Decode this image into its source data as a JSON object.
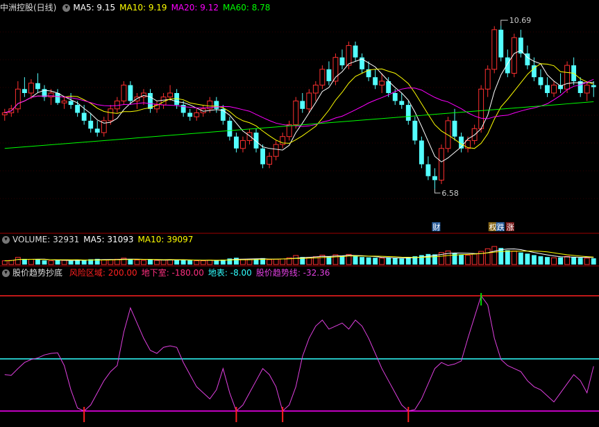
{
  "price_panel": {
    "title": "中洲控股(日线)",
    "indicators": [
      {
        "label": "MA5: 9.15",
        "color": "#ffffff"
      },
      {
        "label": "MA10: 9.19",
        "color": "#ffff00"
      },
      {
        "label": "MA20: 9.12",
        "color": "#ff00ff"
      },
      {
        "label": "MA60: 8.78",
        "color": "#00ff00"
      }
    ],
    "high_label": "10.69",
    "low_label": "6.58",
    "badges": [
      {
        "text": "财",
        "bg": "#2a5d9a"
      },
      {
        "text": "权",
        "bg": "#8a6a1a"
      },
      {
        "text": "跌",
        "bg": "#2a5d9a"
      },
      {
        "text": "涨",
        "bg": "#7a1a1a"
      }
    ]
  },
  "volume_panel": {
    "indicators": [
      {
        "label": "VOLUME: 32931",
        "color": "#dddddd"
      },
      {
        "label": "MA5: 31093",
        "color": "#ffffff"
      },
      {
        "label": "MA10: 39097",
        "color": "#ffff00"
      }
    ]
  },
  "indicator_panel": {
    "title": "股价趋势抄底",
    "indicators": [
      {
        "label": "风险区域: 200.00",
        "color": "#ff2020"
      },
      {
        "label": "地下室: -180.00",
        "color": "#ff3080"
      },
      {
        "label": "地表: -8.00",
        "color": "#30ffff"
      },
      {
        "label": "股价趋势线: -32.36",
        "color": "#e040e0"
      }
    ]
  },
  "chart_data": {
    "type": "candlestick",
    "price_range": [
      6.0,
      11.0
    ],
    "series_colors": {
      "up": "#ff3030",
      "down": "#54ffff",
      "ma5": "#ffffff",
      "ma10": "#ffff00",
      "ma20": "#ff00ff",
      "ma60": "#00ff00"
    },
    "candles": [
      [
        8.45,
        8.6,
        8.3,
        8.5
      ],
      [
        8.5,
        8.7,
        8.4,
        8.6
      ],
      [
        8.6,
        9.3,
        8.5,
        9.1
      ],
      [
        9.1,
        9.4,
        8.9,
        9.0
      ],
      [
        9.0,
        9.35,
        8.85,
        9.25
      ],
      [
        9.25,
        9.5,
        9.0,
        9.1
      ],
      [
        9.1,
        9.2,
        8.8,
        8.9
      ],
      [
        8.9,
        9.1,
        8.7,
        9.0
      ],
      [
        9.0,
        9.1,
        8.7,
        8.75
      ],
      [
        8.75,
        8.9,
        8.6,
        8.8
      ],
      [
        8.8,
        9.0,
        8.6,
        8.7
      ],
      [
        8.7,
        8.8,
        8.4,
        8.5
      ],
      [
        8.5,
        8.7,
        8.2,
        8.3
      ],
      [
        8.3,
        8.5,
        8.0,
        8.1
      ],
      [
        8.1,
        8.3,
        7.9,
        8.0
      ],
      [
        8.0,
        8.4,
        7.9,
        8.3
      ],
      [
        8.3,
        8.7,
        8.2,
        8.6
      ],
      [
        8.6,
        8.9,
        8.5,
        8.8
      ],
      [
        8.8,
        9.3,
        8.7,
        9.2
      ],
      [
        9.2,
        9.3,
        8.7,
        8.8
      ],
      [
        8.8,
        9.0,
        8.6,
        8.9
      ],
      [
        8.9,
        9.1,
        8.7,
        9.0
      ],
      [
        9.0,
        9.1,
        8.5,
        8.6
      ],
      [
        8.6,
        8.8,
        8.5,
        8.7
      ],
      [
        8.7,
        9.0,
        8.6,
        8.9
      ],
      [
        8.9,
        9.2,
        8.8,
        9.0
      ],
      [
        9.0,
        9.1,
        8.6,
        8.7
      ],
      [
        8.7,
        8.8,
        8.4,
        8.5
      ],
      [
        8.5,
        8.6,
        8.3,
        8.4
      ],
      [
        8.4,
        8.6,
        8.3,
        8.5
      ],
      [
        8.5,
        8.7,
        8.4,
        8.6
      ],
      [
        8.6,
        8.9,
        8.5,
        8.8
      ],
      [
        8.8,
        8.9,
        8.5,
        8.6
      ],
      [
        8.6,
        8.7,
        8.2,
        8.3
      ],
      [
        8.3,
        8.4,
        7.8,
        7.9
      ],
      [
        7.9,
        8.0,
        7.5,
        7.6
      ],
      [
        7.6,
        7.9,
        7.5,
        7.8
      ],
      [
        7.8,
        8.1,
        7.7,
        8.0
      ],
      [
        8.0,
        8.1,
        7.5,
        7.6
      ],
      [
        7.6,
        7.7,
        7.1,
        7.2
      ],
      [
        7.2,
        7.5,
        7.1,
        7.4
      ],
      [
        7.4,
        7.8,
        7.3,
        7.7
      ],
      [
        7.7,
        8.0,
        7.6,
        7.9
      ],
      [
        7.9,
        8.3,
        7.8,
        8.2
      ],
      [
        8.2,
        8.9,
        8.1,
        8.8
      ],
      [
        8.8,
        9.0,
        8.5,
        8.6
      ],
      [
        8.6,
        9.1,
        8.5,
        9.0
      ],
      [
        9.0,
        9.3,
        8.8,
        9.2
      ],
      [
        9.2,
        9.7,
        9.1,
        9.6
      ],
      [
        9.6,
        9.8,
        9.2,
        9.3
      ],
      [
        9.3,
        10.0,
        9.2,
        9.9
      ],
      [
        9.9,
        10.1,
        9.6,
        9.7
      ],
      [
        9.7,
        10.3,
        9.6,
        10.2
      ],
      [
        10.2,
        10.3,
        9.8,
        9.9
      ],
      [
        9.9,
        10.0,
        9.5,
        9.6
      ],
      [
        9.6,
        9.8,
        9.3,
        9.4
      ],
      [
        9.4,
        9.6,
        9.1,
        9.2
      ],
      [
        9.2,
        9.5,
        9.0,
        9.3
      ],
      [
        9.3,
        9.4,
        8.9,
        9.0
      ],
      [
        9.0,
        9.1,
        8.7,
        8.8
      ],
      [
        8.8,
        9.0,
        8.6,
        8.7
      ],
      [
        8.7,
        8.8,
        8.2,
        8.3
      ],
      [
        8.3,
        8.4,
        7.7,
        7.8
      ],
      [
        7.8,
        7.9,
        7.1,
        7.2
      ],
      [
        7.2,
        7.4,
        6.8,
        6.9
      ],
      [
        6.9,
        7.1,
        6.58,
        6.8
      ],
      [
        6.8,
        7.7,
        6.7,
        7.6
      ],
      [
        7.6,
        8.4,
        7.5,
        8.3
      ],
      [
        8.3,
        8.6,
        7.8,
        7.9
      ],
      [
        7.9,
        8.0,
        7.5,
        7.6
      ],
      [
        7.6,
        7.9,
        7.5,
        7.8
      ],
      [
        7.8,
        8.2,
        7.7,
        8.1
      ],
      [
        8.1,
        9.2,
        8.0,
        9.1
      ],
      [
        9.1,
        9.7,
        8.9,
        9.6
      ],
      [
        9.6,
        10.69,
        9.5,
        10.6
      ],
      [
        10.6,
        10.7,
        9.8,
        9.9
      ],
      [
        9.9,
        10.1,
        9.4,
        9.5
      ],
      [
        9.5,
        10.5,
        9.4,
        10.4
      ],
      [
        10.4,
        10.6,
        9.9,
        10.0
      ],
      [
        10.0,
        10.2,
        9.6,
        9.7
      ],
      [
        9.7,
        9.9,
        9.3,
        9.4
      ],
      [
        9.4,
        9.6,
        9.1,
        9.2
      ],
      [
        9.2,
        9.4,
        8.9,
        9.0
      ],
      [
        9.0,
        9.3,
        8.9,
        9.2
      ],
      [
        9.2,
        9.5,
        9.0,
        9.1
      ],
      [
        9.1,
        9.8,
        9.0,
        9.7
      ],
      [
        9.7,
        9.9,
        9.2,
        9.3
      ],
      [
        9.3,
        9.4,
        8.9,
        9.0
      ],
      [
        9.0,
        9.3,
        8.8,
        9.2
      ],
      [
        9.2,
        9.3,
        8.9,
        9.15
      ]
    ],
    "volume": [
      20,
      22,
      38,
      30,
      28,
      26,
      22,
      20,
      24,
      22,
      20,
      24,
      26,
      28,
      30,
      24,
      26,
      28,
      34,
      30,
      24,
      22,
      26,
      22,
      24,
      26,
      24,
      26,
      22,
      20,
      20,
      24,
      22,
      26,
      32,
      36,
      28,
      26,
      30,
      34,
      26,
      28,
      30,
      36,
      48,
      40,
      38,
      42,
      50,
      44,
      52,
      46,
      54,
      44,
      40,
      38,
      36,
      34,
      36,
      34,
      32,
      38,
      44,
      50,
      56,
      54,
      64,
      72,
      60,
      54,
      50,
      56,
      70,
      84,
      96,
      88,
      76,
      72,
      64,
      58,
      50,
      44,
      40,
      36,
      38,
      44,
      40,
      36,
      34,
      33
    ],
    "trend_line": [
      -60,
      -62,
      -40,
      -20,
      -10,
      -5,
      5,
      10,
      12,
      -30,
      -110,
      -170,
      -180,
      -160,
      -120,
      -80,
      -50,
      -30,
      80,
      160,
      110,
      60,
      20,
      10,
      30,
      35,
      30,
      -20,
      -60,
      -100,
      -120,
      -140,
      -110,
      -40,
      -120,
      -180,
      -160,
      -120,
      -80,
      -40,
      -60,
      -100,
      -180,
      -160,
      -100,
      0,
      60,
      100,
      120,
      90,
      100,
      110,
      90,
      120,
      100,
      60,
      10,
      -40,
      -80,
      -120,
      -160,
      -180,
      -175,
      -140,
      -90,
      -40,
      -20,
      -30,
      -25,
      -15,
      60,
      130,
      200,
      170,
      60,
      -10,
      -30,
      -40,
      -50,
      -80,
      -100,
      -110,
      -130,
      -150,
      -120,
      -90,
      -60,
      -80,
      -120,
      -32.36
    ],
    "risk_level": 200,
    "surface_level": -8,
    "basement_level": -180
  }
}
